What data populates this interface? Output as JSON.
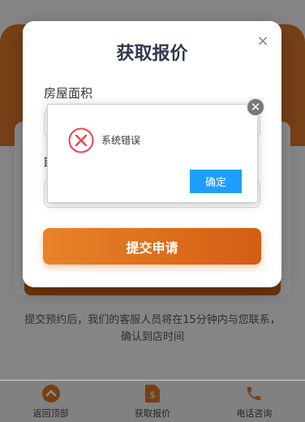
{
  "background": {
    "note": "提交预约后，我们的客服人员将在15分钟内与您联系，确认到店时间"
  },
  "modal": {
    "title": "获取报价",
    "close_symbol": "×",
    "field_area_label": "房屋面积",
    "field_contact_label": "联",
    "submit_label": "提交申请"
  },
  "error_dialog": {
    "icon": "error-x-icon",
    "message": "系统错误",
    "ok_label": "确定",
    "close_symbol": "✕"
  },
  "bottom_nav": {
    "items": [
      {
        "label": "返回顶部",
        "icon": "chevron-up-icon"
      },
      {
        "label": "获取报价",
        "icon": "quote-document-icon"
      },
      {
        "label": "电话咨询",
        "icon": "phone-icon"
      }
    ]
  },
  "colors": {
    "accent": "#d9772b",
    "primary_blue": "#1e9fff",
    "error_red": "#e5484d"
  }
}
